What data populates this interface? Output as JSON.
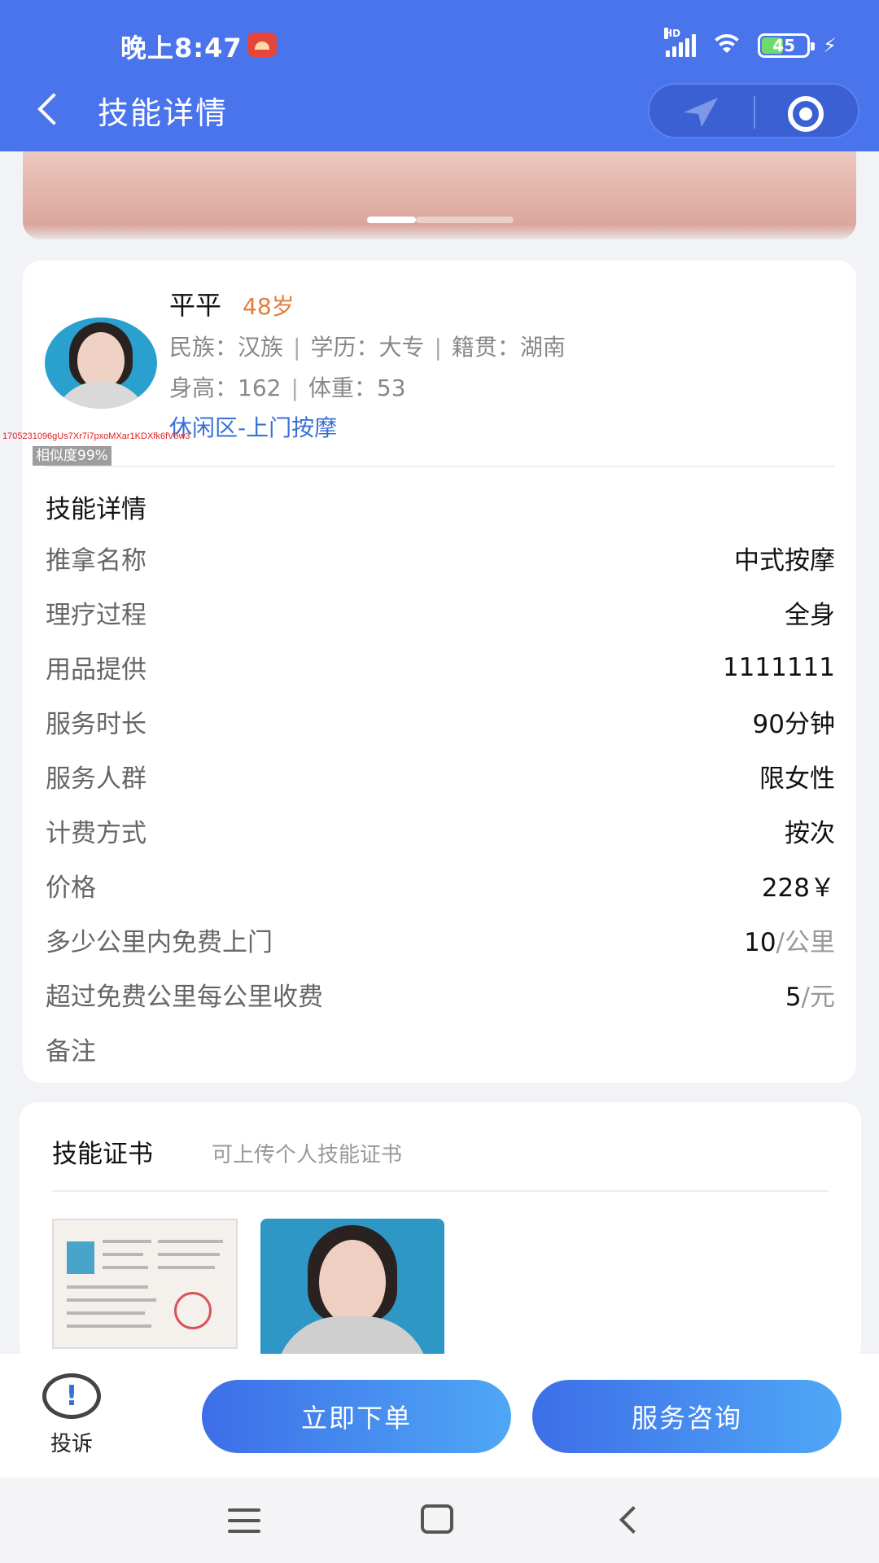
{
  "status_bar": {
    "time": "晚上8:47",
    "network_label": "HD",
    "battery_level": "45"
  },
  "header": {
    "title": "技能详情"
  },
  "banner": {
    "slide_count": 3,
    "active_slide": 1
  },
  "profile": {
    "name": "平平",
    "age": "48岁",
    "ethnicity_label": "民族：汉族",
    "education_label": "学历：大专",
    "hometown_label": "籍贯：湖南",
    "height_label": "身高：162",
    "weight_label": "体重：53",
    "service_category": "休闲区-上门按摩",
    "watermark": "1705231096gUs7Xr7i7pxoMXar1KDXfk6fV5w3",
    "similarity": "相似度99%"
  },
  "skill_details": {
    "section_title": "技能详情",
    "rows": [
      {
        "label": "推拿名称",
        "value": "中式按摩",
        "unit": ""
      },
      {
        "label": "理疗过程",
        "value": "全身",
        "unit": ""
      },
      {
        "label": "用品提供",
        "value": "1111111",
        "unit": ""
      },
      {
        "label": "服务时长",
        "value": "90分钟",
        "unit": ""
      },
      {
        "label": "服务人群",
        "value": "限女性",
        "unit": ""
      },
      {
        "label": "计费方式",
        "value": "按次",
        "unit": ""
      },
      {
        "label": "价格",
        "value": "228￥",
        "unit": ""
      },
      {
        "label": "多少公里内免费上门",
        "value": "10",
        "unit": "/公里"
      },
      {
        "label": "超过免费公里每公里收费",
        "value": "5",
        "unit": "/元"
      },
      {
        "label": "备注",
        "value": "",
        "unit": ""
      }
    ]
  },
  "certificates": {
    "title": "技能证书",
    "hint": "可上传个人技能证书"
  },
  "actions": {
    "complain_label": "投诉",
    "order_label": "立即下单",
    "consult_label": "服务咨询"
  },
  "colors": {
    "brand": "#4a74ec",
    "age": "#e07e3d",
    "link": "#3b6fd8"
  }
}
